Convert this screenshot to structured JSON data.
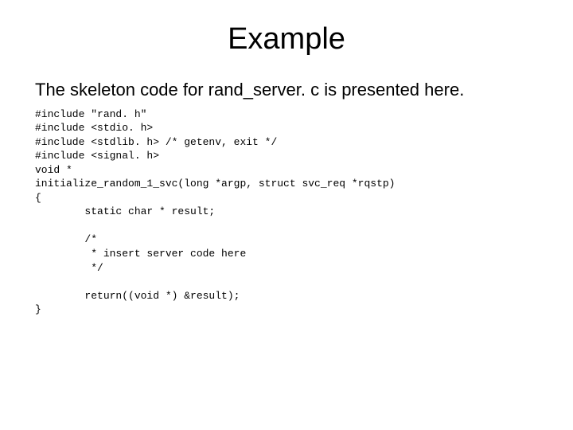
{
  "title": "Example",
  "description": "The skeleton code for rand_server. c is presented here.",
  "code": "#include \"rand. h\"\n#include <stdio. h>\n#include <stdlib. h> /* getenv, exit */\n#include <signal. h>\nvoid *\ninitialize_random_1_svc(long *argp, struct svc_req *rqstp)\n{\n        static char * result;\n\n        /*\n         * insert server code here\n         */\n\n        return((void *) &result);\n}"
}
